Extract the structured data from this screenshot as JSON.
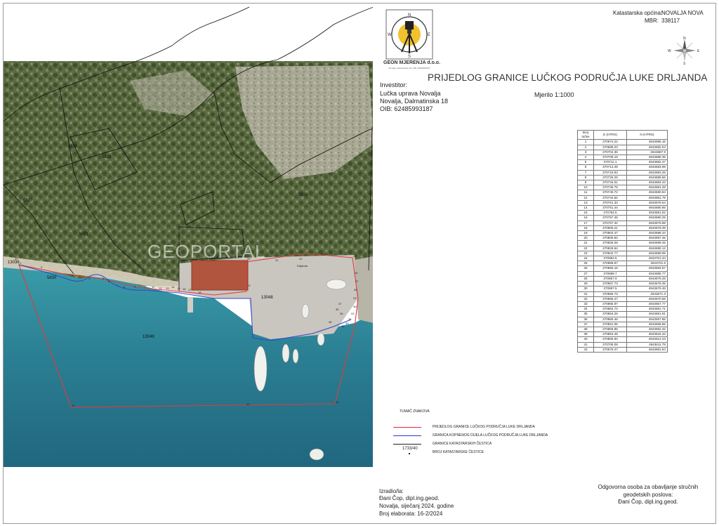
{
  "title": "PRIJEDLOG GRANICE LUČKOG PODRUČJA LUKE DRLJANDA",
  "company": {
    "name": "GEON MJERENJA d.o.o.",
    "address": "Novalja, Dalmatinska 18, OIB: 62485993187",
    "compass_letters": [
      "N",
      "E",
      "S",
      "W"
    ]
  },
  "investor": {
    "label": "Investitor:",
    "name": "Lučka uprava Novalja",
    "address": "Novalja, Dalmatinska 18",
    "oib": "OIB: 62485993187"
  },
  "scale": "Mjerilo 1:1000",
  "cadastral": {
    "municipality_label": "Katastarska općina:",
    "municipality_value": "NOVALJA NOVA",
    "mbr_label": "MBR:",
    "mbr_value": "338117"
  },
  "north_arrow_letters": [
    "N",
    "E",
    "S",
    "W"
  ],
  "map": {
    "watermark": "GEOPORTAL",
    "place_name": "Drljanda",
    "parcels": [
      "5828",
      "5829",
      "5827",
      "5831",
      "5833",
      "5834",
      "5830",
      "13036",
      "13048",
      "13049"
    ]
  },
  "point_numbers": [
    "1",
    "2",
    "3",
    "4",
    "5",
    "6",
    "7",
    "8",
    "9",
    "10",
    "11",
    "12",
    "13",
    "14",
    "15",
    "16",
    "17",
    "18",
    "19",
    "20",
    "21",
    "22",
    "23",
    "24",
    "25",
    "26",
    "27",
    "28",
    "29",
    "30",
    "31",
    "32",
    "33",
    "34",
    "35",
    "36",
    "37",
    "38",
    "39",
    "40",
    "41",
    "42"
  ],
  "coord_table": {
    "headers": [
      "Broj točke",
      "E (HTRS)",
      "N (HTRS)"
    ],
    "rows": [
      [
        "1",
        "370674.22",
        "4943695.15"
      ],
      [
        "2",
        "370686.23",
        "4943692.04"
      ],
      [
        "3",
        "370702.35",
        "4943687.9"
      ],
      [
        "4",
        "370709.19",
        "4943688.35"
      ],
      [
        "5",
        "370711.1",
        "4943692.47"
      ],
      [
        "6",
        "370713.49",
        "4943693.99"
      ],
      [
        "7",
        "370716.83",
        "4943693.26"
      ],
      [
        "8",
        "370726.29",
        "4943688.56"
      ],
      [
        "9",
        "370734.61",
        "4943684.43"
      ],
      [
        "10",
        "370736.75",
        "4943681.28"
      ],
      [
        "11",
        "370740.72",
        "4943680.84"
      ],
      [
        "12",
        "370744.52",
        "4943681.79"
      ],
      [
        "13",
        "370751.33",
        "4943678.54"
      ],
      [
        "14",
        "370751.44",
        "4943680.66"
      ],
      [
        "15",
        "370754.5",
        "4943681.52"
      ],
      [
        "16",
        "370757.45",
        "4943680.25"
      ],
      [
        "17",
        "370767.32",
        "4943679.98"
      ],
      [
        "18",
        "370805.21",
        "4943679.39"
      ],
      [
        "19",
        "370804.47",
        "4943698.34"
      ],
      [
        "20",
        "370805.82",
        "4943697.45"
      ],
      [
        "21",
        "370825.06",
        "4943699.25"
      ],
      [
        "22",
        "370829.84",
        "4943699.12"
      ],
      [
        "23",
        "370842.77",
        "4943699.99"
      ],
      [
        "24",
        "370852.5",
        "4943701.34"
      ],
      [
        "25",
        "370858.87",
        "4943701.6"
      ],
      [
        "26",
        "370865.16",
        "4943684.87"
      ],
      [
        "27",
        "370868.7",
        "4943685.77"
      ],
      [
        "28",
        "370867.9",
        "4943679.28"
      ],
      [
        "29",
        "370867.73",
        "4943678.35"
      ],
      [
        "30",
        "370867.5",
        "4943676.48"
      ],
      [
        "31",
        "370866.73",
        "4943671.3"
      ],
      [
        "32",
        "370866.47",
        "4943670.58"
      ],
      [
        "33",
        "370865.97",
        "4943667.77"
      ],
      [
        "34",
        "370864.74",
        "4943661.71"
      ],
      [
        "35",
        "370864.26",
        "4943661.81"
      ],
      [
        "36",
        "370865.46",
        "4943667.86"
      ],
      [
        "37",
        "370861.05",
        "4943668.65"
      ],
      [
        "38",
        "370859.85",
        "4943662.32"
      ],
      [
        "39",
        "370854.49",
        "4943616.43"
      ],
      [
        "40",
        "370805.94",
        "4943612.23"
      ],
      [
        "41",
        "370706.09",
        "4943611.79"
      ],
      [
        "42",
        "370675.47",
        "4943691.84"
      ]
    ]
  },
  "legend": {
    "title": "TUMAČ ZNAKOVA",
    "items": [
      {
        "label": "PRIJEDLOG GRANICE LUČKOG PODRUČJA LUKE DRLJANDA",
        "color": "#e23b3b"
      },
      {
        "label": "GRANICA KOPNENOG DIJELA LUČKOG PODRUČJA LUKE DRLJANDA",
        "color": "#3344cc"
      },
      {
        "label": "GRANICE KATASTARSKIH ČESTICA",
        "color": "#222222"
      },
      {
        "label": "BROJ KATASTARSKE ČESTICE",
        "color": "#222222"
      }
    ],
    "sample_number": "1733/40"
  },
  "prepared": {
    "label": "Izradio/la:",
    "name": "Đani Čop, dipl.ing.geod.",
    "place_date": "Novalja, siječanj 2024. godine",
    "number": "Broj elaborata: 16-2/2024"
  },
  "responsible": {
    "line1": "Odgovorna osoba za obavljanje stručnih",
    "line2": "geodetskih poslova:",
    "name": "Đani Čop, dipl.ing.geod."
  }
}
